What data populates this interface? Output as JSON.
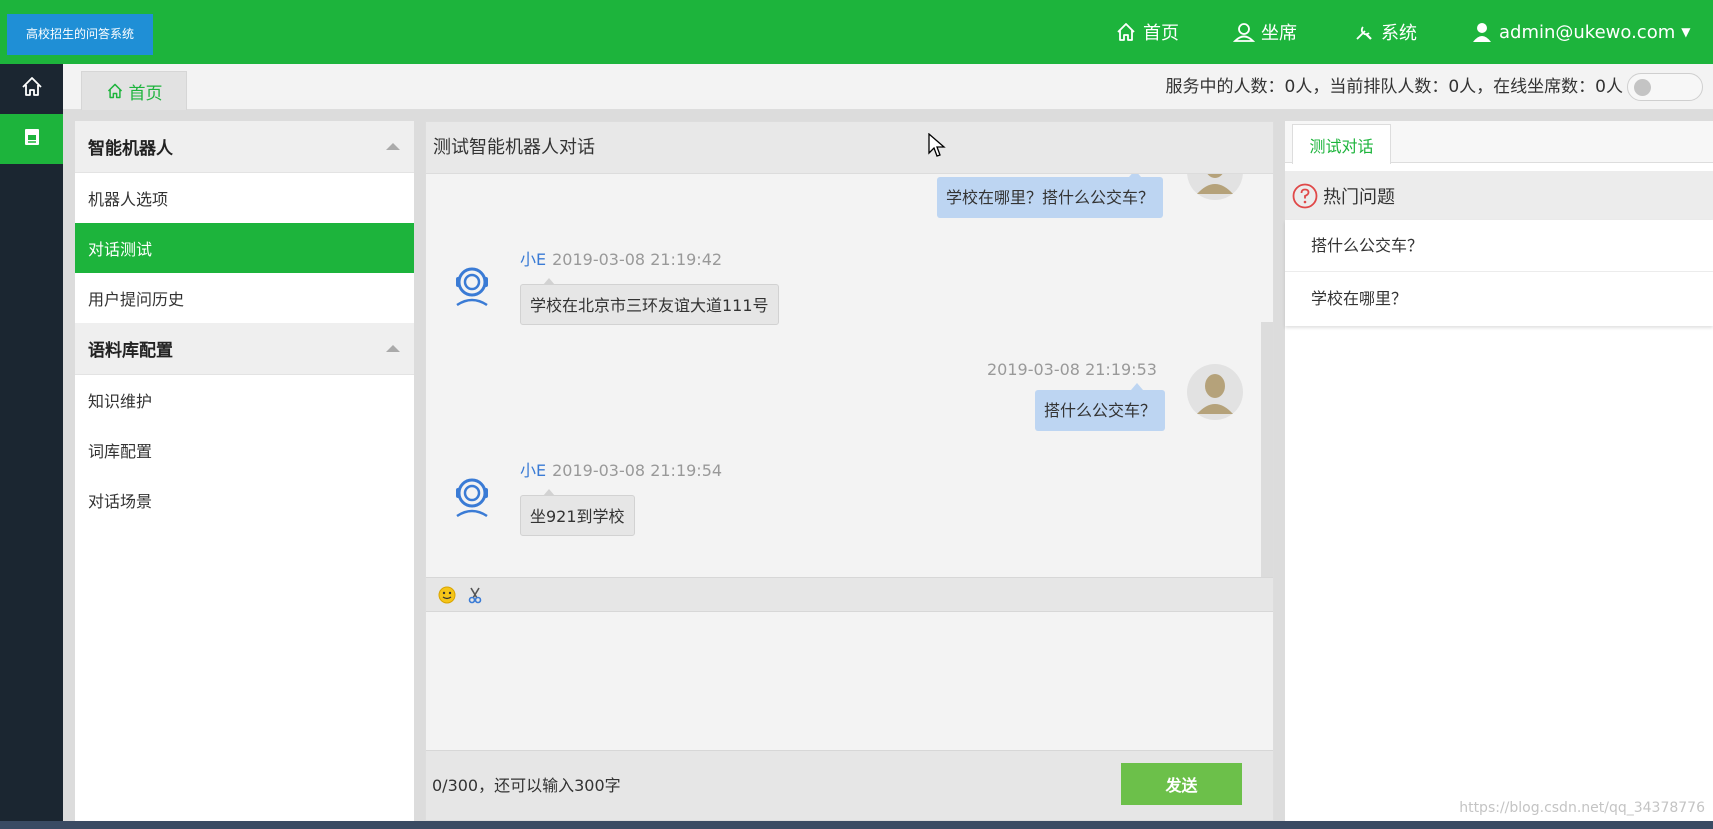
{
  "app": {
    "logo_text": "高校招生的问答系统",
    "brand_color": "#1db43c"
  },
  "topnav": {
    "home": "首页",
    "agent": "坐席",
    "system": "系统",
    "user": "admin@ukewo.com"
  },
  "tabs": {
    "home": "首页"
  },
  "status": {
    "text": "服务中的人数：0人，当前排队人数：0人，在线坐席数：0人"
  },
  "menu": {
    "group1": "智能机器人",
    "robot_options": "机器人选项",
    "dialog_test": "对话测试",
    "user_history": "用户提问历史",
    "group2": "语料库配置",
    "knowledge": "知识维护",
    "lexicon": "词库配置",
    "scenes": "对话场景"
  },
  "chat": {
    "title": "测试智能机器人对话",
    "messages": [
      {
        "from": "user",
        "time": "",
        "text": "学校在哪里？搭什么公交车？"
      },
      {
        "from": "bot",
        "name": "小E",
        "time": "2019-03-08 21:19:42",
        "text": "学校在北京市三环友谊大道111号"
      },
      {
        "from": "user",
        "time": "2019-03-08 21:19:53",
        "text": "搭什么公交车？"
      },
      {
        "from": "bot",
        "name": "小E",
        "time": "2019-03-08 21:19:54",
        "text": "坐921到学校"
      }
    ],
    "counter": "0/300，还可以输入300字",
    "send": "发送"
  },
  "right": {
    "tab": "测试对话",
    "hot_title": "热门问题",
    "hot": [
      "搭什么公交车？",
      "学校在哪里？"
    ]
  },
  "watermark": "https://blog.csdn.net/qq_34378776"
}
